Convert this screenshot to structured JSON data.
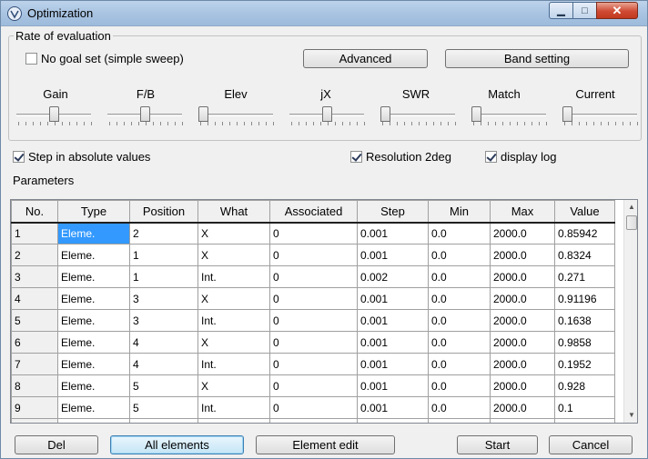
{
  "window": {
    "title": "Optimization",
    "icon": "app-icon",
    "controls": {
      "minimize": "▁",
      "maximize": "□",
      "close": "✕"
    }
  },
  "evaluation": {
    "group_label": "Rate of evaluation",
    "no_goal_label": "No goal set (simple sweep)",
    "no_goal_checked": false,
    "advanced_label": "Advanced",
    "band_setting_label": "Band setting",
    "sliders": [
      {
        "label": "Gain",
        "level": 0.5
      },
      {
        "label": "F/B",
        "level": 0.5
      },
      {
        "label": "Elev",
        "level": 0.0
      },
      {
        "label": "jX",
        "level": 0.5
      },
      {
        "label": "SWR",
        "level": 0.0
      },
      {
        "label": "Match",
        "level": 0.0
      },
      {
        "label": "Current",
        "level": 0.0
      }
    ]
  },
  "options": {
    "step_absolute_label": "Step in absolute values",
    "step_absolute_checked": true,
    "resolution_label": "Resolution 2deg",
    "resolution_checked": true,
    "display_log_label": "display log",
    "display_log_checked": true
  },
  "parameters": {
    "label": "Parameters",
    "columns": [
      "No.",
      "Type",
      "Position",
      "What",
      "Associated",
      "Step",
      "Min",
      "Max",
      "Value"
    ],
    "rows": [
      [
        "1",
        "Eleme.",
        "2",
        "X",
        "0",
        "0.001",
        "0.0",
        "2000.0",
        "0.85942"
      ],
      [
        "2",
        "Eleme.",
        "1",
        "X",
        "0",
        "0.001",
        "0.0",
        "2000.0",
        "0.8324"
      ],
      [
        "3",
        "Eleme.",
        "1",
        "Int.",
        "0",
        "0.002",
        "0.0",
        "2000.0",
        "0.271"
      ],
      [
        "4",
        "Eleme.",
        "3",
        "X",
        "0",
        "0.001",
        "0.0",
        "2000.0",
        "0.91196"
      ],
      [
        "5",
        "Eleme.",
        "3",
        "Int.",
        "0",
        "0.001",
        "0.0",
        "2000.0",
        "0.1638"
      ],
      [
        "6",
        "Eleme.",
        "4",
        "X",
        "0",
        "0.001",
        "0.0",
        "2000.0",
        "0.9858"
      ],
      [
        "7",
        "Eleme.",
        "4",
        "Int.",
        "0",
        "0.001",
        "0.0",
        "2000.0",
        "0.1952"
      ],
      [
        "8",
        "Eleme.",
        "5",
        "X",
        "0",
        "0.001",
        "0.0",
        "2000.0",
        "0.928"
      ],
      [
        "9",
        "Eleme.",
        "5",
        "Int.",
        "0",
        "0.001",
        "0.0",
        "2000.0",
        "0.1"
      ]
    ],
    "selected_row": 0
  },
  "footer": {
    "del_label": "Del",
    "all_elements_label": "All elements",
    "element_edit_label": "Element edit",
    "start_label": "Start",
    "cancel_label": "Cancel"
  }
}
